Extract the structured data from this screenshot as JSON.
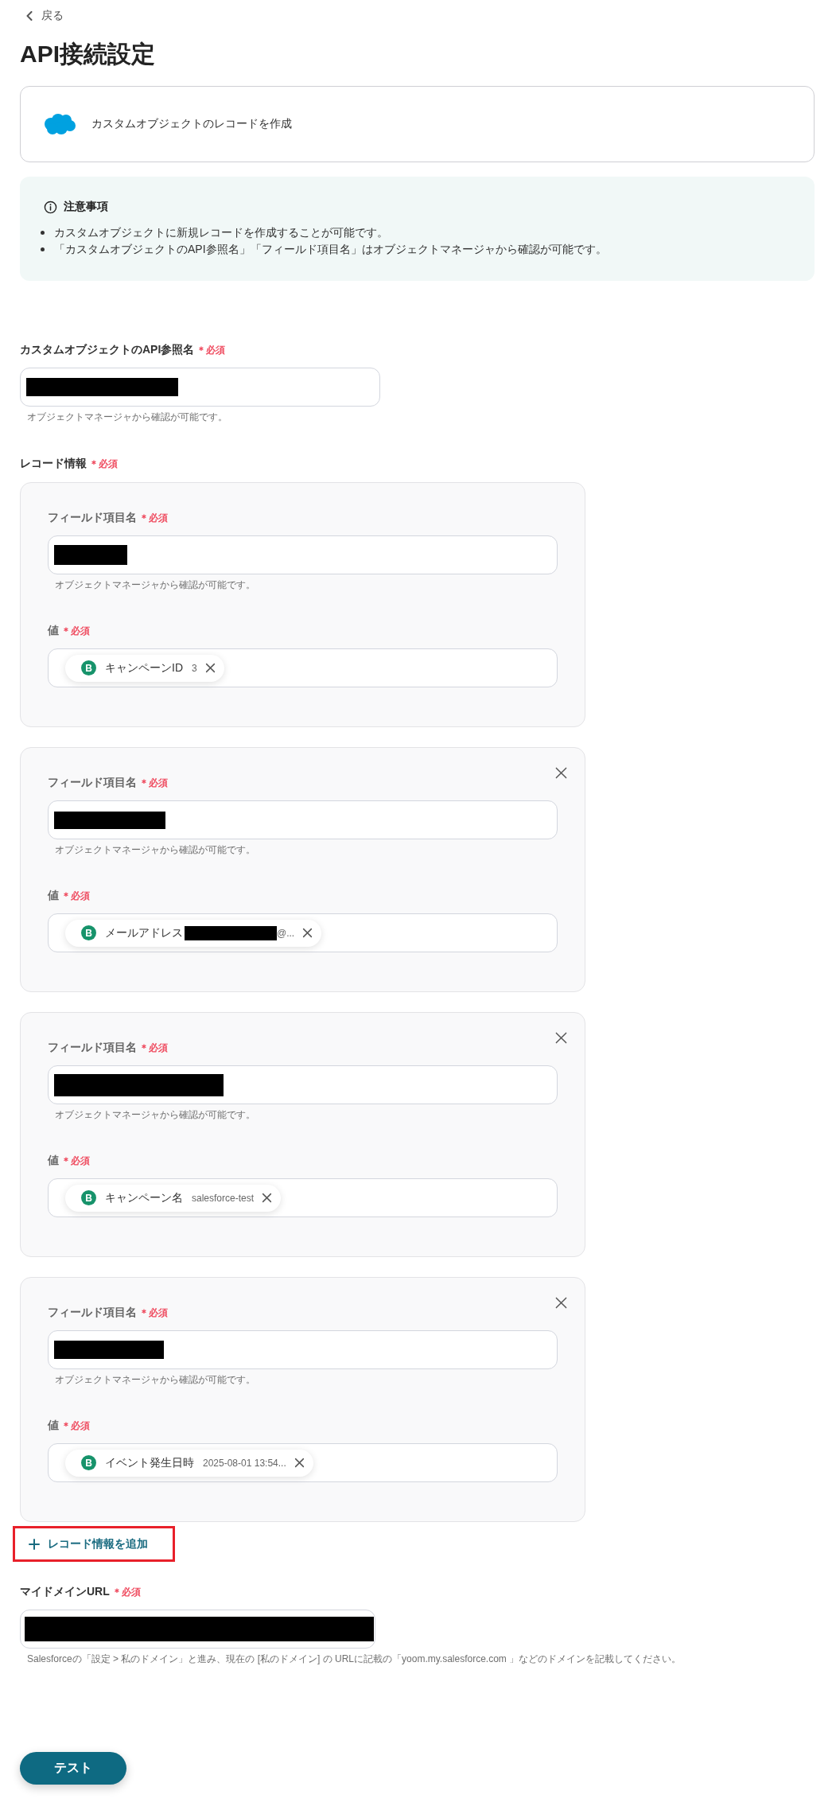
{
  "back_link": {
    "label": "戻る"
  },
  "page_title": "API接続設定",
  "action": {
    "label": "カスタムオブジェクトのレコードを作成"
  },
  "notice": {
    "title": "注意事項",
    "items": [
      "カスタムオブジェクトに新規レコードを作成することが可能です。",
      "「カスタムオブジェクトのAPI参照名」「フィールド項目名」はオブジェクトマネージャから確認が可能です。"
    ]
  },
  "fields": [
    {
      "kind": "text",
      "label": "カスタムオブジェクトのAPI参照名",
      "required_mark": "＊必須",
      "value_redacted": true,
      "hint": "オブジェクトマネージャから確認が可能です。"
    },
    {
      "kind": "records",
      "label": "レコード情報",
      "required_mark": "＊必須",
      "records": [
        {
          "removable": false,
          "name_field": {
            "label": "フィールド項目名",
            "required_mark": "＊必須",
            "value_redacted": true,
            "hint": "オブジェクトマネージャから確認が可能です。"
          },
          "value_field": {
            "label": "値",
            "required_mark": "＊必須",
            "chip": {
              "badge": "B",
              "label": "キャンペーンID",
              "value_redacted": false,
              "value": "3"
            }
          }
        },
        {
          "removable": true,
          "name_field": {
            "label": "フィールド項目名",
            "required_mark": "＊必須",
            "value_redacted": true,
            "hint": "オブジェクトマネージャから確認が可能です。"
          },
          "value_field": {
            "label": "値",
            "required_mark": "＊必須",
            "chip": {
              "badge": "B",
              "label": "メールアドレス",
              "value_redacted": true,
              "value": "@..."
            }
          }
        },
        {
          "removable": true,
          "name_field": {
            "label": "フィールド項目名",
            "required_mark": "＊必須",
            "value_redacted": true,
            "hint": "オブジェクトマネージャから確認が可能です。"
          },
          "value_field": {
            "label": "値",
            "required_mark": "＊必須",
            "chip": {
              "badge": "B",
              "label": "キャンペーン名",
              "value_redacted": false,
              "value": "salesforce-test"
            }
          }
        },
        {
          "removable": true,
          "name_field": {
            "label": "フィールド項目名",
            "required_mark": "＊必須",
            "value_redacted": true,
            "hint": "オブジェクトマネージャから確認が可能です。"
          },
          "value_field": {
            "label": "値",
            "required_mark": "＊必須",
            "chip": {
              "badge": "B",
              "label": "イベント発生日時",
              "value_redacted": false,
              "value": "2025-08-01 13:54..."
            }
          }
        }
      ],
      "add_button": {
        "label": "レコード情報を追加",
        "highlighted": true
      }
    },
    {
      "kind": "text",
      "label": "マイドメインURL",
      "required_mark": "＊必須",
      "value_redacted": true,
      "hint": "Salesforceの「設定 > 私のドメイン」と進み、現在の [私のドメイン] の URLに記載の「yoom.my.salesforce.com 」などのドメインを記載してください。"
    }
  ],
  "test_button": {
    "label": "テスト"
  }
}
